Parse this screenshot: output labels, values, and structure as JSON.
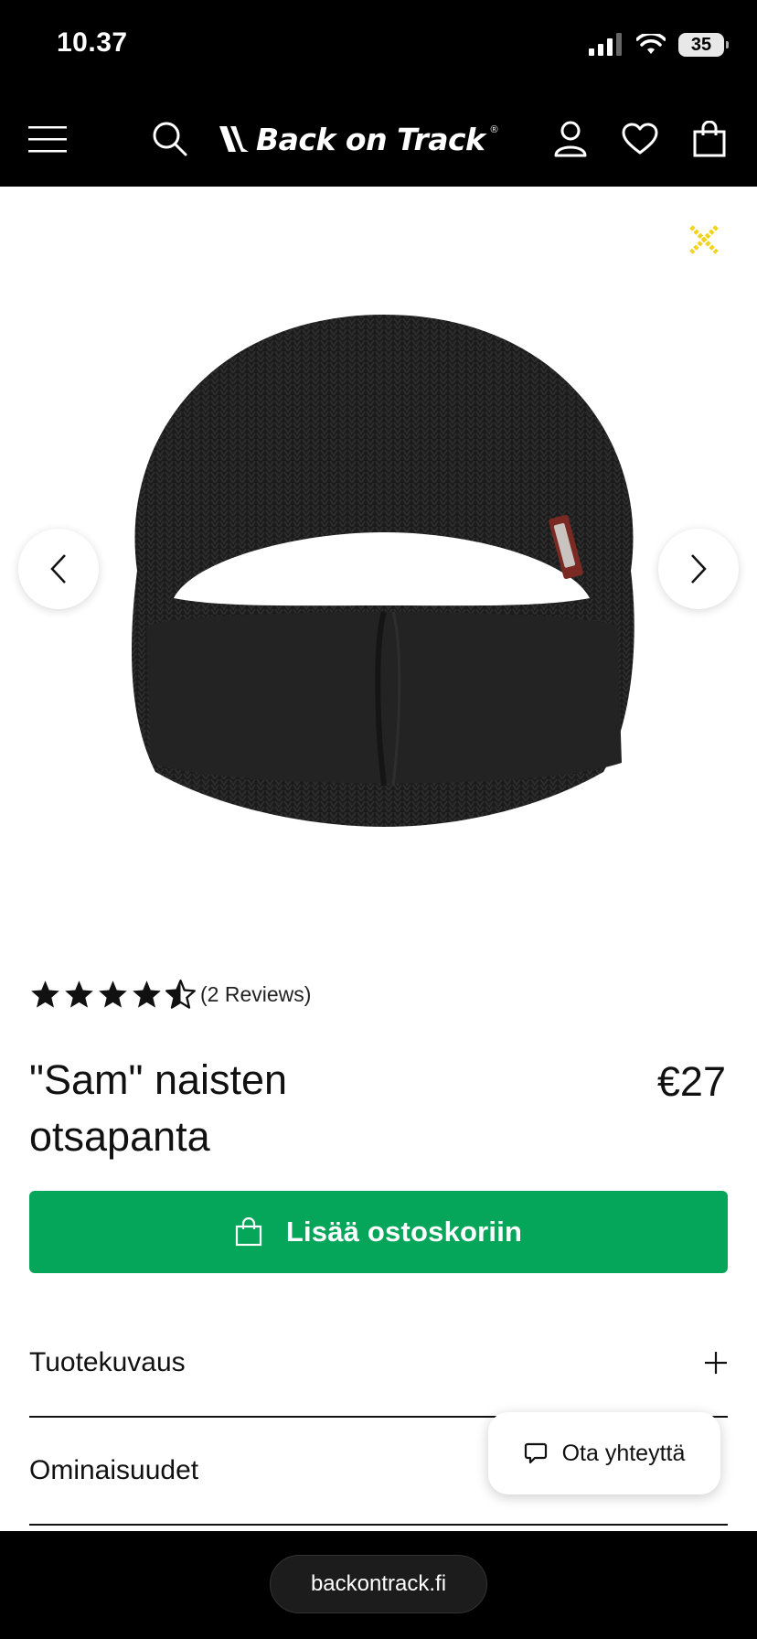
{
  "status_bar": {
    "time": "10.37",
    "battery": "35"
  },
  "header": {
    "brand": "Back on Track",
    "icons": [
      "menu-icon",
      "search-icon",
      "account-icon",
      "heart-icon",
      "shopping-bag-icon"
    ]
  },
  "gallery": {
    "close_icon_color": "#f2d21b"
  },
  "product": {
    "rating": 4.5,
    "reviews_label": "(2 Reviews)",
    "title": "\"Sam\" naisten otsapanta",
    "price": "€27",
    "add_to_cart_label": "Lisää ostoskoriin"
  },
  "accordions": {
    "description_label": "Tuotekuvaus",
    "features_label": "Ominaisuudet"
  },
  "chat": {
    "label": "Ota yhteyttä"
  },
  "browser": {
    "url": "backontrack.fi"
  },
  "colors": {
    "brand_green": "#05a65a",
    "header_bg": "#000000"
  }
}
